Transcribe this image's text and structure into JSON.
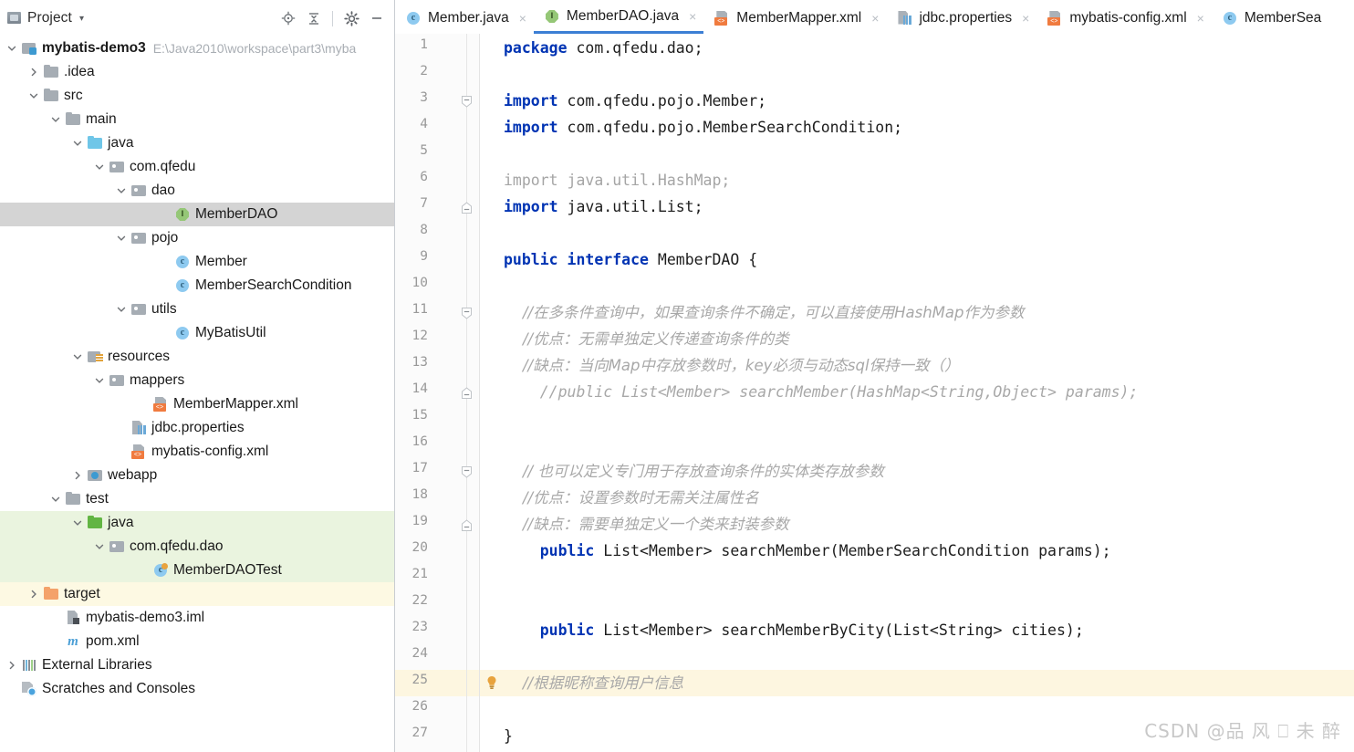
{
  "project_panel": {
    "title": "Project",
    "caret_icon": "chevron-down-icon",
    "toolbar": [
      {
        "name": "locate-icon",
        "label": ""
      },
      {
        "name": "collapse-all-icon",
        "label": ""
      },
      {
        "name": "settings-gear-icon",
        "label": ""
      },
      {
        "name": "minimize-icon",
        "label": ""
      }
    ],
    "tree": [
      {
        "label": "mybatis-demo3",
        "path": "E:\\Java2010\\workspace\\part3\\myba",
        "indent": 0,
        "twist": "down",
        "icon": "module-icon",
        "bold": true,
        "state": ""
      },
      {
        "label": ".idea",
        "path": "",
        "indent": 1,
        "twist": "right",
        "icon": "folder-icon",
        "bold": false,
        "state": ""
      },
      {
        "label": "src",
        "path": "",
        "indent": 1,
        "twist": "down",
        "icon": "folder-icon",
        "bold": false,
        "state": ""
      },
      {
        "label": "main",
        "path": "",
        "indent": 2,
        "twist": "down",
        "icon": "folder-icon",
        "bold": false,
        "state": ""
      },
      {
        "label": "java",
        "path": "",
        "indent": 3,
        "twist": "down",
        "icon": "source-folder-icon",
        "bold": false,
        "state": ""
      },
      {
        "label": "com.qfedu",
        "path": "",
        "indent": 4,
        "twist": "down",
        "icon": "package-icon",
        "bold": false,
        "state": ""
      },
      {
        "label": "dao",
        "path": "",
        "indent": 5,
        "twist": "down",
        "icon": "package-icon",
        "bold": false,
        "state": ""
      },
      {
        "label": "MemberDAO",
        "path": "",
        "indent": 7,
        "twist": "none",
        "icon": "interface-icon",
        "bold": false,
        "state": "selected"
      },
      {
        "label": "pojo",
        "path": "",
        "indent": 5,
        "twist": "down",
        "icon": "package-icon",
        "bold": false,
        "state": ""
      },
      {
        "label": "Member",
        "path": "",
        "indent": 7,
        "twist": "none",
        "icon": "class-icon",
        "bold": false,
        "state": ""
      },
      {
        "label": "MemberSearchCondition",
        "path": "",
        "indent": 7,
        "twist": "none",
        "icon": "class-icon",
        "bold": false,
        "state": ""
      },
      {
        "label": "utils",
        "path": "",
        "indent": 5,
        "twist": "down",
        "icon": "package-icon",
        "bold": false,
        "state": ""
      },
      {
        "label": "MyBatisUtil",
        "path": "",
        "indent": 7,
        "twist": "none",
        "icon": "class-icon",
        "bold": false,
        "state": ""
      },
      {
        "label": "resources",
        "path": "",
        "indent": 3,
        "twist": "down",
        "icon": "resources-folder-icon",
        "bold": false,
        "state": ""
      },
      {
        "label": "mappers",
        "path": "",
        "indent": 4,
        "twist": "down",
        "icon": "package-icon",
        "bold": false,
        "state": ""
      },
      {
        "label": "MemberMapper.xml",
        "path": "",
        "indent": 6,
        "twist": "none",
        "icon": "xml-file-icon",
        "bold": false,
        "state": ""
      },
      {
        "label": "jdbc.properties",
        "path": "",
        "indent": 5,
        "twist": "none",
        "icon": "properties-file-icon",
        "bold": false,
        "state": ""
      },
      {
        "label": "mybatis-config.xml",
        "path": "",
        "indent": 5,
        "twist": "none",
        "icon": "xml-file-icon",
        "bold": false,
        "state": ""
      },
      {
        "label": "webapp",
        "path": "",
        "indent": 3,
        "twist": "right",
        "icon": "webapp-folder-icon",
        "bold": false,
        "state": ""
      },
      {
        "label": "test",
        "path": "",
        "indent": 2,
        "twist": "down",
        "icon": "folder-icon",
        "bold": false,
        "state": ""
      },
      {
        "label": "java",
        "path": "",
        "indent": 3,
        "twist": "down",
        "icon": "test-source-folder-icon",
        "bold": false,
        "state": "green"
      },
      {
        "label": "com.qfedu.dao",
        "path": "",
        "indent": 4,
        "twist": "down",
        "icon": "package-icon",
        "bold": false,
        "state": "green"
      },
      {
        "label": "MemberDAOTest",
        "path": "",
        "indent": 6,
        "twist": "none",
        "icon": "test-class-icon",
        "bold": false,
        "state": "green"
      },
      {
        "label": "target",
        "path": "",
        "indent": 1,
        "twist": "right",
        "icon": "target-folder-icon",
        "bold": false,
        "state": "yellow"
      },
      {
        "label": "mybatis-demo3.iml",
        "path": "",
        "indent": 2,
        "twist": "none",
        "icon": "iml-file-icon",
        "bold": false,
        "state": ""
      },
      {
        "label": "pom.xml",
        "path": "",
        "indent": 2,
        "twist": "none",
        "icon": "maven-pom-icon",
        "bold": false,
        "state": ""
      },
      {
        "label": "External Libraries",
        "path": "",
        "indent": 0,
        "twist": "right",
        "icon": "external-libraries-icon",
        "bold": false,
        "state": ""
      },
      {
        "label": "Scratches and Consoles",
        "path": "",
        "indent": 0,
        "twist": "none",
        "icon": "scratches-icon",
        "bold": false,
        "state": ""
      }
    ]
  },
  "editor": {
    "tabs": [
      {
        "label": "Member.java",
        "icon": "class-icon",
        "active": false,
        "close": "×"
      },
      {
        "label": "MemberDAO.java",
        "icon": "interface-icon",
        "active": true,
        "close": "×"
      },
      {
        "label": "MemberMapper.xml",
        "icon": "xml-file-icon",
        "active": false,
        "close": "×"
      },
      {
        "label": "jdbc.properties",
        "icon": "properties-file-icon",
        "active": false,
        "close": "×"
      },
      {
        "label": "mybatis-config.xml",
        "icon": "xml-file-icon",
        "active": false,
        "close": "×"
      },
      {
        "label": "MemberSea",
        "icon": "class-icon",
        "active": false,
        "close": ""
      }
    ],
    "line_numbers": [
      "1",
      "2",
      "3",
      "4",
      "5",
      "6",
      "7",
      "8",
      "9",
      "10",
      "11",
      "12",
      "13",
      "14",
      "15",
      "16",
      "17",
      "18",
      "19",
      "20",
      "21",
      "22",
      "23",
      "24",
      "25",
      "26",
      "27"
    ],
    "fold_marks": [
      3,
      7,
      11,
      14,
      17,
      19
    ],
    "highlighted_line": 25,
    "intention_bulb_line": 25,
    "code_lines": [
      {
        "n": 1,
        "tokens": [
          {
            "t": "package",
            "c": "kw"
          },
          {
            "t": " com.qfedu.dao;",
            "c": "plain"
          }
        ]
      },
      {
        "n": 2,
        "tokens": []
      },
      {
        "n": 3,
        "tokens": [
          {
            "t": "import",
            "c": "kw"
          },
          {
            "t": " com.qfedu.pojo.Member;",
            "c": "plain"
          }
        ]
      },
      {
        "n": 4,
        "tokens": [
          {
            "t": "import",
            "c": "kw"
          },
          {
            "t": " com.qfedu.pojo.MemberSearchCondition;",
            "c": "plain"
          }
        ]
      },
      {
        "n": 5,
        "tokens": []
      },
      {
        "n": 6,
        "tokens": [
          {
            "t": "import",
            "c": "dim"
          },
          {
            "t": " java.util.HashMap;",
            "c": "dim"
          }
        ]
      },
      {
        "n": 7,
        "tokens": [
          {
            "t": "import",
            "c": "kw"
          },
          {
            "t": " java.util.List;",
            "c": "plain"
          }
        ]
      },
      {
        "n": 8,
        "tokens": []
      },
      {
        "n": 9,
        "tokens": [
          {
            "t": "public",
            "c": "kw"
          },
          {
            "t": " ",
            "c": "plain"
          },
          {
            "t": "interface",
            "c": "kw"
          },
          {
            "t": " MemberDAO {",
            "c": "plain"
          }
        ]
      },
      {
        "n": 10,
        "tokens": []
      },
      {
        "n": 11,
        "tokens": [
          {
            "t": "    //在多条件查询中，如果查询条件不确定，可以直接使用HashMap作为参数",
            "c": "cmt cn"
          }
        ]
      },
      {
        "n": 12,
        "tokens": [
          {
            "t": "    //优点：无需单独定义传递查询条件的类",
            "c": "cmt cn"
          }
        ]
      },
      {
        "n": 13,
        "tokens": [
          {
            "t": "    //缺点：当向Map中存放参数时，key必须与动态sql保持一致（）",
            "c": "cmt cn"
          }
        ]
      },
      {
        "n": 14,
        "tokens": [
          {
            "t": "    //public List<Member> searchMember(HashMap<String,Object> params);",
            "c": "cmt"
          }
        ]
      },
      {
        "n": 15,
        "tokens": []
      },
      {
        "n": 16,
        "tokens": []
      },
      {
        "n": 17,
        "tokens": [
          {
            "t": "    // 也可以定义专门用于存放查询条件的实体类存放参数",
            "c": "cmt cn"
          }
        ]
      },
      {
        "n": 18,
        "tokens": [
          {
            "t": "    //优点：设置参数时无需关注属性名",
            "c": "cmt cn"
          }
        ]
      },
      {
        "n": 19,
        "tokens": [
          {
            "t": "    //缺点：需要单独定义一个类来封装参数",
            "c": "cmt cn"
          }
        ]
      },
      {
        "n": 20,
        "tokens": [
          {
            "t": "    ",
            "c": "plain"
          },
          {
            "t": "public",
            "c": "kw"
          },
          {
            "t": " List<Member> searchMember(MemberSearchCondition params);",
            "c": "plain"
          }
        ]
      },
      {
        "n": 21,
        "tokens": []
      },
      {
        "n": 22,
        "tokens": []
      },
      {
        "n": 23,
        "tokens": [
          {
            "t": "    ",
            "c": "plain"
          },
          {
            "t": "public",
            "c": "kw"
          },
          {
            "t": " List<Member> searchMemberByCity(List<String> cities);",
            "c": "plain"
          }
        ]
      },
      {
        "n": 24,
        "tokens": []
      },
      {
        "n": 25,
        "tokens": [
          {
            "t": "    //根据昵称查询用户信息",
            "c": "cmt cn"
          }
        ]
      },
      {
        "n": 26,
        "tokens": []
      },
      {
        "n": 27,
        "tokens": [
          {
            "t": "}",
            "c": "plain"
          }
        ]
      }
    ]
  },
  "watermark": {
    "text": "CSDN @品 风 ⎕ 未 醉"
  },
  "colors": {
    "accent_blue": "#3c7fd4",
    "keyword_blue": "#0033b3",
    "selection_grey": "#d4d4d4",
    "test_green": "#eaf4df",
    "target_yellow": "#fdf9e3",
    "highlight_yellow": "#fdf6e0",
    "comment_grey": "#a8a8a8"
  }
}
